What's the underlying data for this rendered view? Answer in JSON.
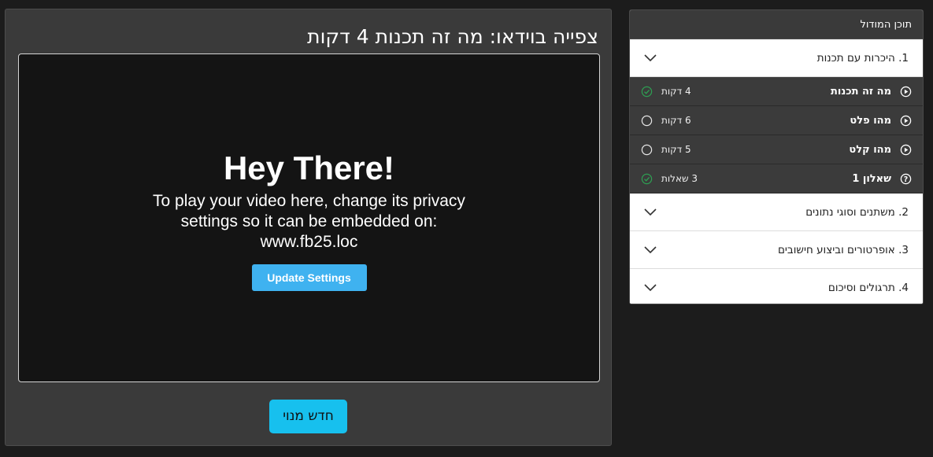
{
  "video": {
    "title": "צפייה בוידאו: מה זה תכנות 4 דקות",
    "embed_heading": "Hey There!",
    "embed_text": "To play your video here, change its privacy settings so it can be embedded on:",
    "embed_url": "www.fb25.loc",
    "update_button": "Update Settings",
    "primary_button": "חדש מנוי"
  },
  "sidebar": {
    "header": "תוכן המודול",
    "sections": [
      {
        "label": "1. היכרות עם תכנות",
        "expanded": true,
        "lessons": [
          {
            "title": "מה זה תכנות",
            "meta": "4 דקות",
            "icon": "play-circle-icon",
            "status": "completed"
          },
          {
            "title": "מהו פלט",
            "meta": "6 דקות",
            "icon": "play-circle-icon",
            "status": "incomplete"
          },
          {
            "title": "מהו קלט",
            "meta": "5 דקות",
            "icon": "play-circle-icon",
            "status": "incomplete"
          },
          {
            "title": "שאלון 1",
            "meta": "3 שאלות",
            "icon": "question-circle-icon",
            "status": "completed"
          }
        ]
      },
      {
        "label": "2. משתנים וסוגי נתונים",
        "expanded": false
      },
      {
        "label": "3. אופרטורים וביצוע חישובים",
        "expanded": false
      },
      {
        "label": "4. תרגולים וסיכום",
        "expanded": false
      }
    ]
  },
  "colors": {
    "page_bg": "#1c1c1c",
    "panel_bg": "#3a3a3a",
    "primary_button": "#17c0ee",
    "update_button": "#3fb2f0",
    "completed_check": "#2e9e52"
  }
}
